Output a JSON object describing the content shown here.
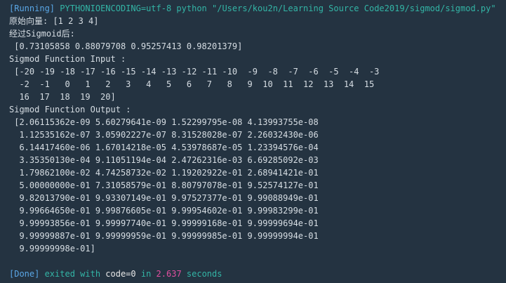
{
  "header": {
    "running_tag": "[Running]",
    "command": "PYTHONIOENCODING=utf-8 python \"/Users/kou2n/Learning Source Code2019/sigmod/sigmod.py\""
  },
  "output_lines": [
    "原始向量: [1 2 3 4]",
    "经过Sigmoid后:",
    " [0.73105858 0.88079708 0.95257413 0.98201379]",
    "Sigmod Function Input :",
    " [-20 -19 -18 -17 -16 -15 -14 -13 -12 -11 -10  -9  -8  -7  -6  -5  -4  -3",
    "  -2  -1   0   1   2   3   4   5   6   7   8   9  10  11  12  13  14  15",
    "  16  17  18  19  20]",
    "Sigmod Function Output :",
    " [2.06115362e-09 5.60279641e-09 1.52299795e-08 4.13993755e-08",
    "  1.12535162e-07 3.05902227e-07 8.31528028e-07 2.26032430e-06",
    "  6.14417460e-06 1.67014218e-05 4.53978687e-05 1.23394576e-04",
    "  3.35350130e-04 9.11051194e-04 2.47262316e-03 6.69285092e-03",
    "  1.79862100e-02 4.74258732e-02 1.19202922e-01 2.68941421e-01",
    "  5.00000000e-01 7.31058579e-01 8.80797078e-01 9.52574127e-01",
    "  9.82013790e-01 9.93307149e-01 9.97527377e-01 9.99088949e-01",
    "  9.99664650e-01 9.99876605e-01 9.99954602e-01 9.99983299e-01",
    "  9.99993856e-01 9.99997740e-01 9.99999168e-01 9.99999694e-01",
    "  9.99999887e-01 9.99999959e-01 9.99999985e-01 9.99999994e-01",
    "  9.99999998e-01]"
  ],
  "footer": {
    "done_tag": "[Done]",
    "text_before_code": " exited with ",
    "code_key": "code=0",
    "text_in": " in ",
    "time_value": "2.637",
    "text_after": " seconds"
  },
  "colors": {
    "background": "#243341",
    "tag_blue": "#5aa7e6",
    "command_teal": "#33b5a6",
    "output_text": "#d6dde3",
    "time_pink": "#e24fa0"
  }
}
